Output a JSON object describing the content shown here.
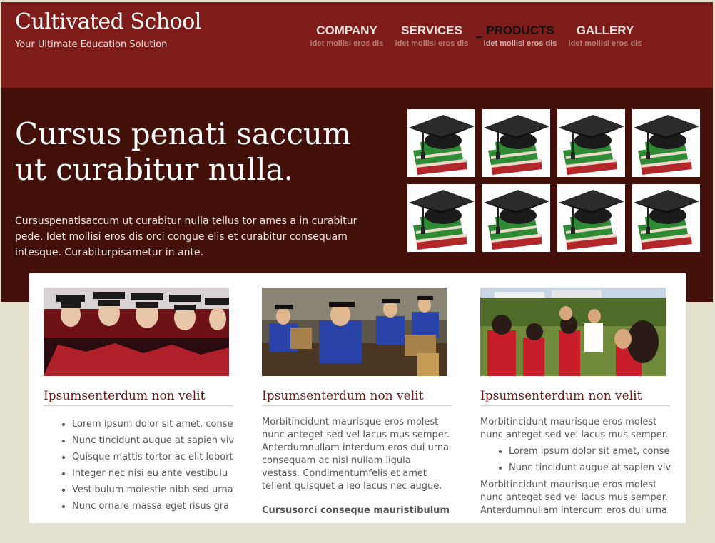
{
  "site": {
    "title": "Cultivated School",
    "tagline": "Your Ultimate Education Solution"
  },
  "nav": [
    {
      "label": "COMPANY",
      "sub": "idet mollisi eros dis"
    },
    {
      "label": "SERVICES",
      "sub": "idet mollisi eros dis"
    },
    {
      "label": "PRODUCTS",
      "sub": "idet mollisi eros dis",
      "active": true
    },
    {
      "label": "GALLERY",
      "sub": "idet mollisi eros dis"
    }
  ],
  "hero": {
    "title": "Cursus penati saccum ut curabitur nulla.",
    "text": "Cursuspenatisaccum ut curabitur nulla tellus tor ames a in curabitur pede. Idet mollisi eros dis orci congue elis et curabitur consequam intesque. Curabiturpisametur in ante.",
    "tiles": [
      "graduation-cap-books-icon",
      "graduation-cap-books-icon",
      "graduation-cap-books-icon",
      "graduation-cap-books-icon",
      "graduation-cap-books-icon",
      "graduation-cap-books-icon",
      "graduation-cap-books-icon",
      "graduation-cap-books-icon"
    ]
  },
  "columns": [
    {
      "title": "Ipsumsenterdum non velit",
      "list": [
        "Lorem ipsum dolor sit amet, conse",
        "Nunc tincidunt augue at sapien viv",
        "Quisque mattis tortor ac elit lobort",
        "Integer nec nisi eu ante vestibulu",
        "Vestibulum molestie nibh sed urna",
        "Nunc ornare massa eget risus gra"
      ]
    },
    {
      "title": "Ipsumsenterdum non velit",
      "paragraph": "Morbitincidunt maurisque eros molest nunc anteget sed vel lacus mus semper. Anterdumnullam interdum eros dui urna consequam ac nisl nullam ligula vestass. Condimentumfelis et amet tellent quisquet a leo lacus nec augue.",
      "strong": "Cursusorci conseque mauristibulum"
    },
    {
      "title": "Ipsumsenterdum non velit",
      "paragraph": "Morbitincidunt maurisque eros molest nunc anteget sed vel lacus mus semper.",
      "list": [
        "Lorem ipsum dolor sit amet, conse",
        "Nunc tincidunt augue at sapien viv"
      ],
      "paragraph2": "Morbitincidunt maurisque eros molest nunc anteget sed vel lacus mus semper. Anterdumnullam interdum eros dui urna"
    }
  ],
  "colors": {
    "header": "#7e1c1a",
    "hero": "#431009",
    "page": "#e3e0cd",
    "heading": "#6b1814"
  }
}
